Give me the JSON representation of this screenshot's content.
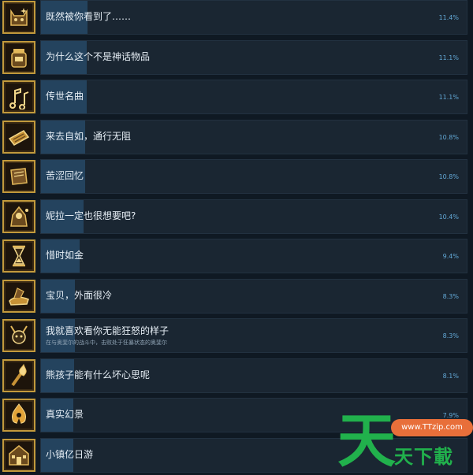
{
  "achievements": [
    {
      "name": "既然被你看到了……",
      "pct": "11.4%",
      "percent": 11.4,
      "icon": "cat-face-icon"
    },
    {
      "name": "为什么这个不是神话物品",
      "pct": "11.1%",
      "percent": 11.1,
      "icon": "jar-icon"
    },
    {
      "name": "传世名曲",
      "pct": "11.1%",
      "percent": 11.1,
      "icon": "music-notes-icon"
    },
    {
      "name": "来去自如，通行无阻",
      "pct": "10.8%",
      "percent": 10.8,
      "icon": "ticket-icon"
    },
    {
      "name": "苦涩回忆",
      "pct": "10.8%",
      "percent": 10.8,
      "icon": "book-icon"
    },
    {
      "name": "妮拉一定也很想要吧?",
      "pct": "10.4%",
      "percent": 10.4,
      "icon": "hooded-figure-icon"
    },
    {
      "name": "惜时如金",
      "pct": "9.4%",
      "percent": 9.4,
      "icon": "hourglass-icon"
    },
    {
      "name": "宝贝，外面很冷",
      "pct": "8.3%",
      "percent": 8.3,
      "icon": "hand-cloth-icon"
    },
    {
      "name": "我就喜欢看你无能狂怒的样子",
      "desc": "在与奥斐尔的战斗中，击败处于狂暴状态的奥斐尔",
      "pct": "8.3%",
      "percent": 8.3,
      "icon": "horned-head-icon"
    },
    {
      "name": "熊孩子能有什么坏心思呢",
      "pct": "8.1%",
      "percent": 8.1,
      "icon": "torch-icon"
    },
    {
      "name": "真实幻景",
      "pct": "7.9%",
      "percent": 7.9,
      "icon": "flame-figure-icon"
    },
    {
      "name": "小镇亿日游",
      "pct": "",
      "percent": 7.8,
      "icon": "building-icon"
    }
  ],
  "watermark": {
    "big": "天",
    "small": "天下載",
    "url": "www.TTzip.com"
  },
  "colors": {
    "background": "#0f1923",
    "bar": "#1a2632",
    "fill": "#24435e",
    "percent_text": "#62a8d6",
    "icon_frame": "#c29a3c",
    "watermark_green": "#21b14c",
    "watermark_orange": "#e86f3a"
  }
}
